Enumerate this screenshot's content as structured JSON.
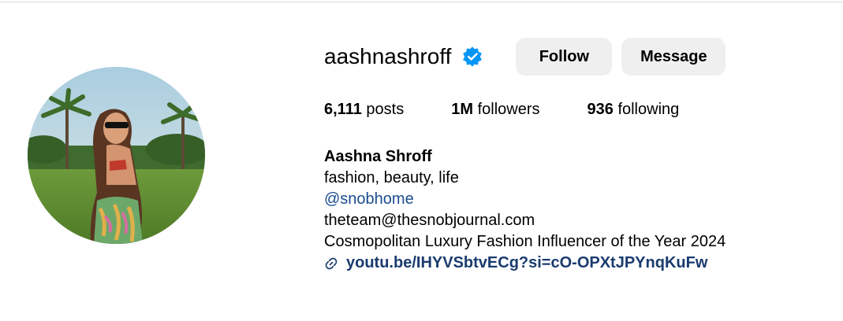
{
  "profile": {
    "username": "aashnashroff",
    "verified": true,
    "follow_label": "Follow",
    "message_label": "Message",
    "stats": {
      "posts_count": "6,111",
      "posts_label": "posts",
      "followers_count": "1M",
      "followers_label": "followers",
      "following_count": "936",
      "following_label": "following"
    },
    "bio": {
      "full_name": "Aashna Shroff",
      "tagline": "fashion, beauty, life",
      "mention": "@snobhome",
      "email": "theteam@thesnobjournal.com",
      "award": "Cosmopolitan Luxury Fashion Influencer of the Year 2024",
      "link": "youtu.be/IHYVSbtvECg?si=cO-OPXtJPYnqKuFw"
    }
  },
  "colors": {
    "verified_blue": "#0095f6",
    "button_bg": "#efefef",
    "mention_color": "#1a4d8f",
    "link_color": "#1a3b6e"
  },
  "icons": {
    "verified": "verified-badge-icon",
    "link": "link-icon"
  }
}
